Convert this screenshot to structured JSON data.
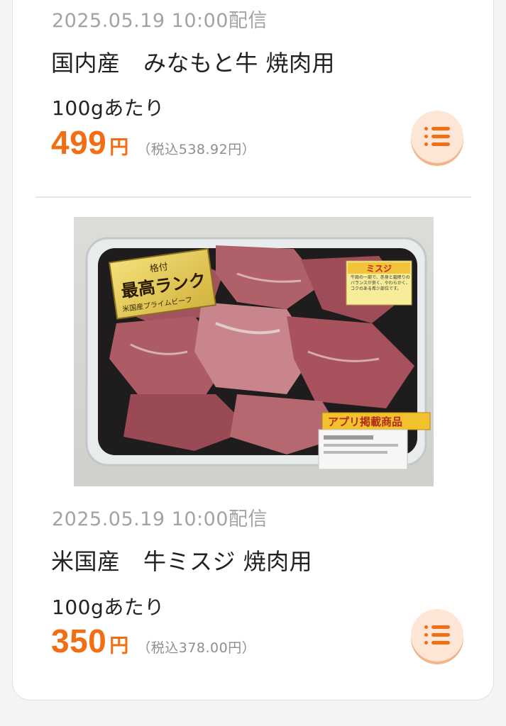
{
  "items": [
    {
      "date": "2025.05.19 10:00配信",
      "name": "国内産　みなもと牛 焼肉用",
      "unit": "100gあたり",
      "price": "499",
      "yen": "円",
      "tax": "（税込538.92円）"
    },
    {
      "photo_labels": {
        "grade_small": "格付",
        "grade_big": "最高ランク",
        "grade_sub": "米国産プライムビーフ",
        "tag_title": "ミスジ",
        "tag_text": "牛肩の一部で、赤身と霜降りのバランスが良く、やわらかく、コクのある希少部位です。",
        "app_sticker": "アプリ掲載商品"
      },
      "date": "2025.05.19 10:00配信",
      "name": "米国産　牛ミスジ 焼肉用",
      "unit": "100gあたり",
      "price": "350",
      "yen": "円",
      "tax": "（税込378.00円）"
    }
  ]
}
